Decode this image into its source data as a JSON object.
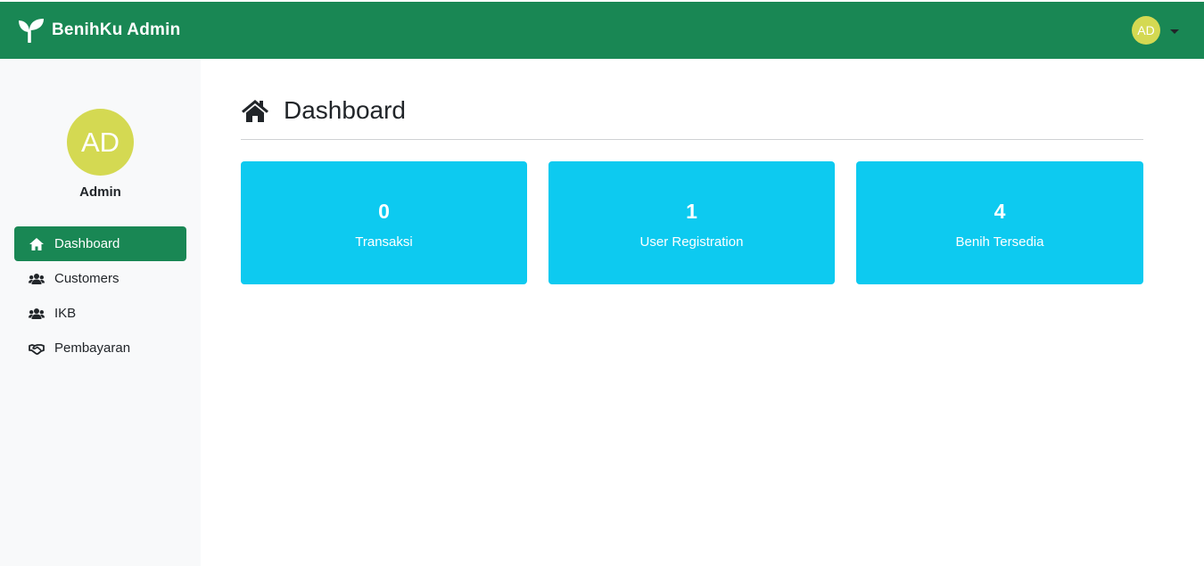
{
  "app": {
    "brand": "BenihKu Admin",
    "brand_icon": "seedling-icon"
  },
  "colors": {
    "primary": "#198754",
    "card": "#0dcaf0",
    "avatar": "#d4d952",
    "sidebar_bg": "#f8f9fa"
  },
  "topbar": {
    "user_initials": "AD",
    "dropdown_icon": "caret-down-icon"
  },
  "sidebar": {
    "avatar_initials": "AD",
    "user_name": "Admin",
    "items": [
      {
        "label": "Dashboard",
        "icon": "home-icon",
        "active": true
      },
      {
        "label": "Customers",
        "icon": "users-icon",
        "active": false
      },
      {
        "label": "IKB",
        "icon": "users-icon",
        "active": false
      },
      {
        "label": "Pembayaran",
        "icon": "handshake-icon",
        "active": false
      }
    ]
  },
  "main": {
    "title": "Dashboard",
    "title_icon": "home-icon",
    "cards": [
      {
        "value": "0",
        "label": "Transaksi"
      },
      {
        "value": "1",
        "label": "User Registration"
      },
      {
        "value": "4",
        "label": "Benih Tersedia"
      }
    ]
  }
}
